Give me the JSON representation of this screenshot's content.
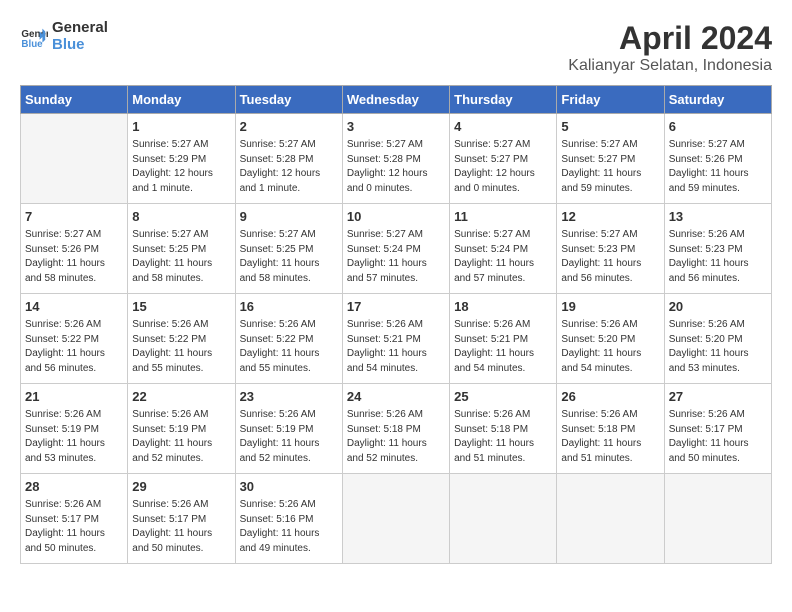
{
  "logo": {
    "line1": "General",
    "line2": "Blue"
  },
  "title": "April 2024",
  "subtitle": "Kalianyar Selatan, Indonesia",
  "headers": [
    "Sunday",
    "Monday",
    "Tuesday",
    "Wednesday",
    "Thursday",
    "Friday",
    "Saturday"
  ],
  "weeks": [
    [
      {
        "day": "",
        "info": ""
      },
      {
        "day": "1",
        "info": "Sunrise: 5:27 AM\nSunset: 5:29 PM\nDaylight: 12 hours\nand 1 minute."
      },
      {
        "day": "2",
        "info": "Sunrise: 5:27 AM\nSunset: 5:28 PM\nDaylight: 12 hours\nand 1 minute."
      },
      {
        "day": "3",
        "info": "Sunrise: 5:27 AM\nSunset: 5:28 PM\nDaylight: 12 hours\nand 0 minutes."
      },
      {
        "day": "4",
        "info": "Sunrise: 5:27 AM\nSunset: 5:27 PM\nDaylight: 12 hours\nand 0 minutes."
      },
      {
        "day": "5",
        "info": "Sunrise: 5:27 AM\nSunset: 5:27 PM\nDaylight: 11 hours\nand 59 minutes."
      },
      {
        "day": "6",
        "info": "Sunrise: 5:27 AM\nSunset: 5:26 PM\nDaylight: 11 hours\nand 59 minutes."
      }
    ],
    [
      {
        "day": "7",
        "info": "Sunrise: 5:27 AM\nSunset: 5:26 PM\nDaylight: 11 hours\nand 58 minutes."
      },
      {
        "day": "8",
        "info": "Sunrise: 5:27 AM\nSunset: 5:25 PM\nDaylight: 11 hours\nand 58 minutes."
      },
      {
        "day": "9",
        "info": "Sunrise: 5:27 AM\nSunset: 5:25 PM\nDaylight: 11 hours\nand 58 minutes."
      },
      {
        "day": "10",
        "info": "Sunrise: 5:27 AM\nSunset: 5:24 PM\nDaylight: 11 hours\nand 57 minutes."
      },
      {
        "day": "11",
        "info": "Sunrise: 5:27 AM\nSunset: 5:24 PM\nDaylight: 11 hours\nand 57 minutes."
      },
      {
        "day": "12",
        "info": "Sunrise: 5:27 AM\nSunset: 5:23 PM\nDaylight: 11 hours\nand 56 minutes."
      },
      {
        "day": "13",
        "info": "Sunrise: 5:26 AM\nSunset: 5:23 PM\nDaylight: 11 hours\nand 56 minutes."
      }
    ],
    [
      {
        "day": "14",
        "info": "Sunrise: 5:26 AM\nSunset: 5:22 PM\nDaylight: 11 hours\nand 56 minutes."
      },
      {
        "day": "15",
        "info": "Sunrise: 5:26 AM\nSunset: 5:22 PM\nDaylight: 11 hours\nand 55 minutes."
      },
      {
        "day": "16",
        "info": "Sunrise: 5:26 AM\nSunset: 5:22 PM\nDaylight: 11 hours\nand 55 minutes."
      },
      {
        "day": "17",
        "info": "Sunrise: 5:26 AM\nSunset: 5:21 PM\nDaylight: 11 hours\nand 54 minutes."
      },
      {
        "day": "18",
        "info": "Sunrise: 5:26 AM\nSunset: 5:21 PM\nDaylight: 11 hours\nand 54 minutes."
      },
      {
        "day": "19",
        "info": "Sunrise: 5:26 AM\nSunset: 5:20 PM\nDaylight: 11 hours\nand 54 minutes."
      },
      {
        "day": "20",
        "info": "Sunrise: 5:26 AM\nSunset: 5:20 PM\nDaylight: 11 hours\nand 53 minutes."
      }
    ],
    [
      {
        "day": "21",
        "info": "Sunrise: 5:26 AM\nSunset: 5:19 PM\nDaylight: 11 hours\nand 53 minutes."
      },
      {
        "day": "22",
        "info": "Sunrise: 5:26 AM\nSunset: 5:19 PM\nDaylight: 11 hours\nand 52 minutes."
      },
      {
        "day": "23",
        "info": "Sunrise: 5:26 AM\nSunset: 5:19 PM\nDaylight: 11 hours\nand 52 minutes."
      },
      {
        "day": "24",
        "info": "Sunrise: 5:26 AM\nSunset: 5:18 PM\nDaylight: 11 hours\nand 52 minutes."
      },
      {
        "day": "25",
        "info": "Sunrise: 5:26 AM\nSunset: 5:18 PM\nDaylight: 11 hours\nand 51 minutes."
      },
      {
        "day": "26",
        "info": "Sunrise: 5:26 AM\nSunset: 5:18 PM\nDaylight: 11 hours\nand 51 minutes."
      },
      {
        "day": "27",
        "info": "Sunrise: 5:26 AM\nSunset: 5:17 PM\nDaylight: 11 hours\nand 50 minutes."
      }
    ],
    [
      {
        "day": "28",
        "info": "Sunrise: 5:26 AM\nSunset: 5:17 PM\nDaylight: 11 hours\nand 50 minutes."
      },
      {
        "day": "29",
        "info": "Sunrise: 5:26 AM\nSunset: 5:17 PM\nDaylight: 11 hours\nand 50 minutes."
      },
      {
        "day": "30",
        "info": "Sunrise: 5:26 AM\nSunset: 5:16 PM\nDaylight: 11 hours\nand 49 minutes."
      },
      {
        "day": "",
        "info": ""
      },
      {
        "day": "",
        "info": ""
      },
      {
        "day": "",
        "info": ""
      },
      {
        "day": "",
        "info": ""
      }
    ]
  ]
}
